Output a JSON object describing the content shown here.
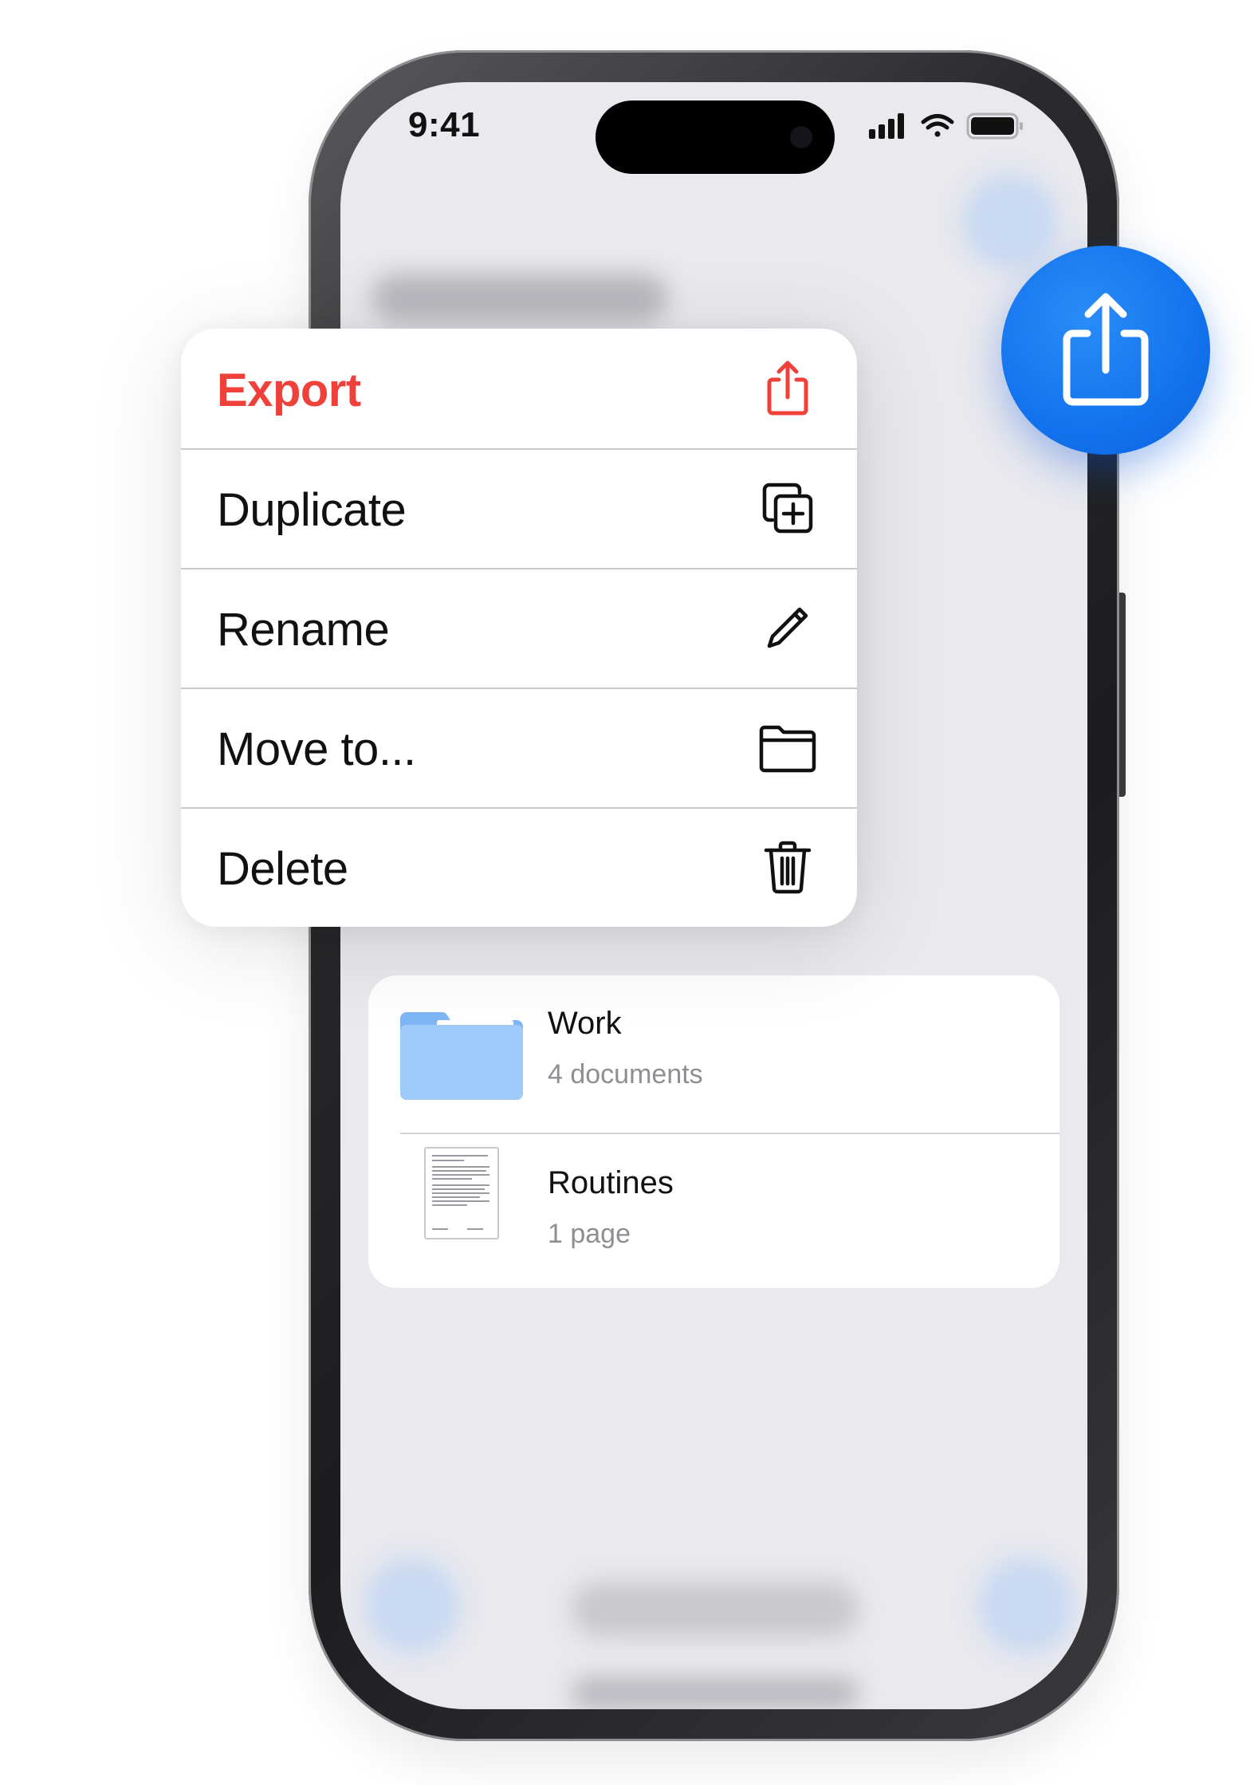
{
  "status_bar": {
    "time": "9:41"
  },
  "context_menu": {
    "items": [
      {
        "label": "Export",
        "icon": "share-icon",
        "destructive_color": "#f0403a"
      },
      {
        "label": "Duplicate",
        "icon": "duplicate-icon"
      },
      {
        "label": "Rename",
        "icon": "pencil-icon"
      },
      {
        "label": "Move to...",
        "icon": "folder-icon"
      },
      {
        "label": "Delete",
        "icon": "trash-icon"
      }
    ]
  },
  "file_list": {
    "rows": [
      {
        "title": "Work",
        "subtitle": "4 documents",
        "icon": "folder-icon"
      },
      {
        "title": "Routines",
        "subtitle": "1 page",
        "icon": "document-icon"
      }
    ]
  },
  "floating_button": {
    "icon": "share-icon",
    "color": "#1373ee"
  },
  "colors": {
    "accent": "#1373ee",
    "danger": "#f0403a",
    "folder": "#9ecbfa",
    "screen_bg": "#e9e9ee"
  }
}
